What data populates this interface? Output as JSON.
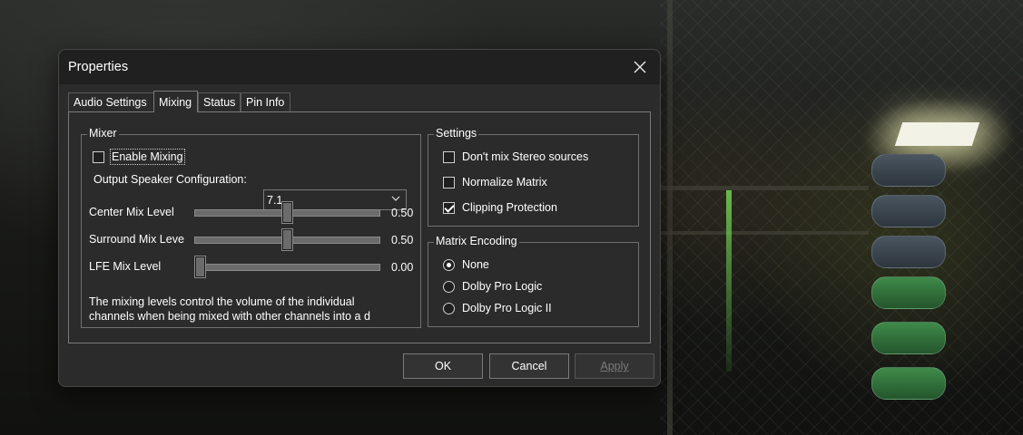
{
  "dialog": {
    "title": "Properties",
    "close_icon": "close-icon"
  },
  "tabs": [
    {
      "label": "Audio Settings",
      "active": false
    },
    {
      "label": "Mixing",
      "active": true
    },
    {
      "label": "Status",
      "active": false
    },
    {
      "label": "Pin Info",
      "active": false
    }
  ],
  "mixer": {
    "group_title": "Mixer",
    "enable_mixing": {
      "label": "Enable Mixing",
      "checked": false
    },
    "output_config": {
      "label": "Output Speaker Configuration:",
      "value": "7.1"
    },
    "sliders": [
      {
        "label": "Center Mix Level",
        "value": "0.50",
        "level": 0.5
      },
      {
        "label": "Surround Mix Leve",
        "value": "0.50",
        "level": 0.5
      },
      {
        "label": "LFE Mix Level",
        "value": "0.00",
        "level": 0.0
      }
    ],
    "description": "The mixing levels control the volume of the individual channels when being mixed with other channels into a d"
  },
  "settings": {
    "group_title": "Settings",
    "options": [
      {
        "label": "Don't mix Stereo sources",
        "checked": false
      },
      {
        "label": "Normalize Matrix",
        "checked": false
      },
      {
        "label": "Clipping Protection",
        "checked": true
      }
    ]
  },
  "matrix_encoding": {
    "group_title": "Matrix Encoding",
    "options": [
      {
        "label": "None",
        "checked": true
      },
      {
        "label": "Dolby Pro Logic",
        "checked": false
      },
      {
        "label": "Dolby Pro Logic II",
        "checked": false
      }
    ]
  },
  "buttons": {
    "ok": "OK",
    "cancel": "Cancel",
    "apply": "Apply"
  },
  "colors": {
    "dialog_bg": "#2b2b2b",
    "titlebar_bg": "#202020",
    "text": "#ffffff",
    "disabled_text": "#7a7a7a"
  }
}
